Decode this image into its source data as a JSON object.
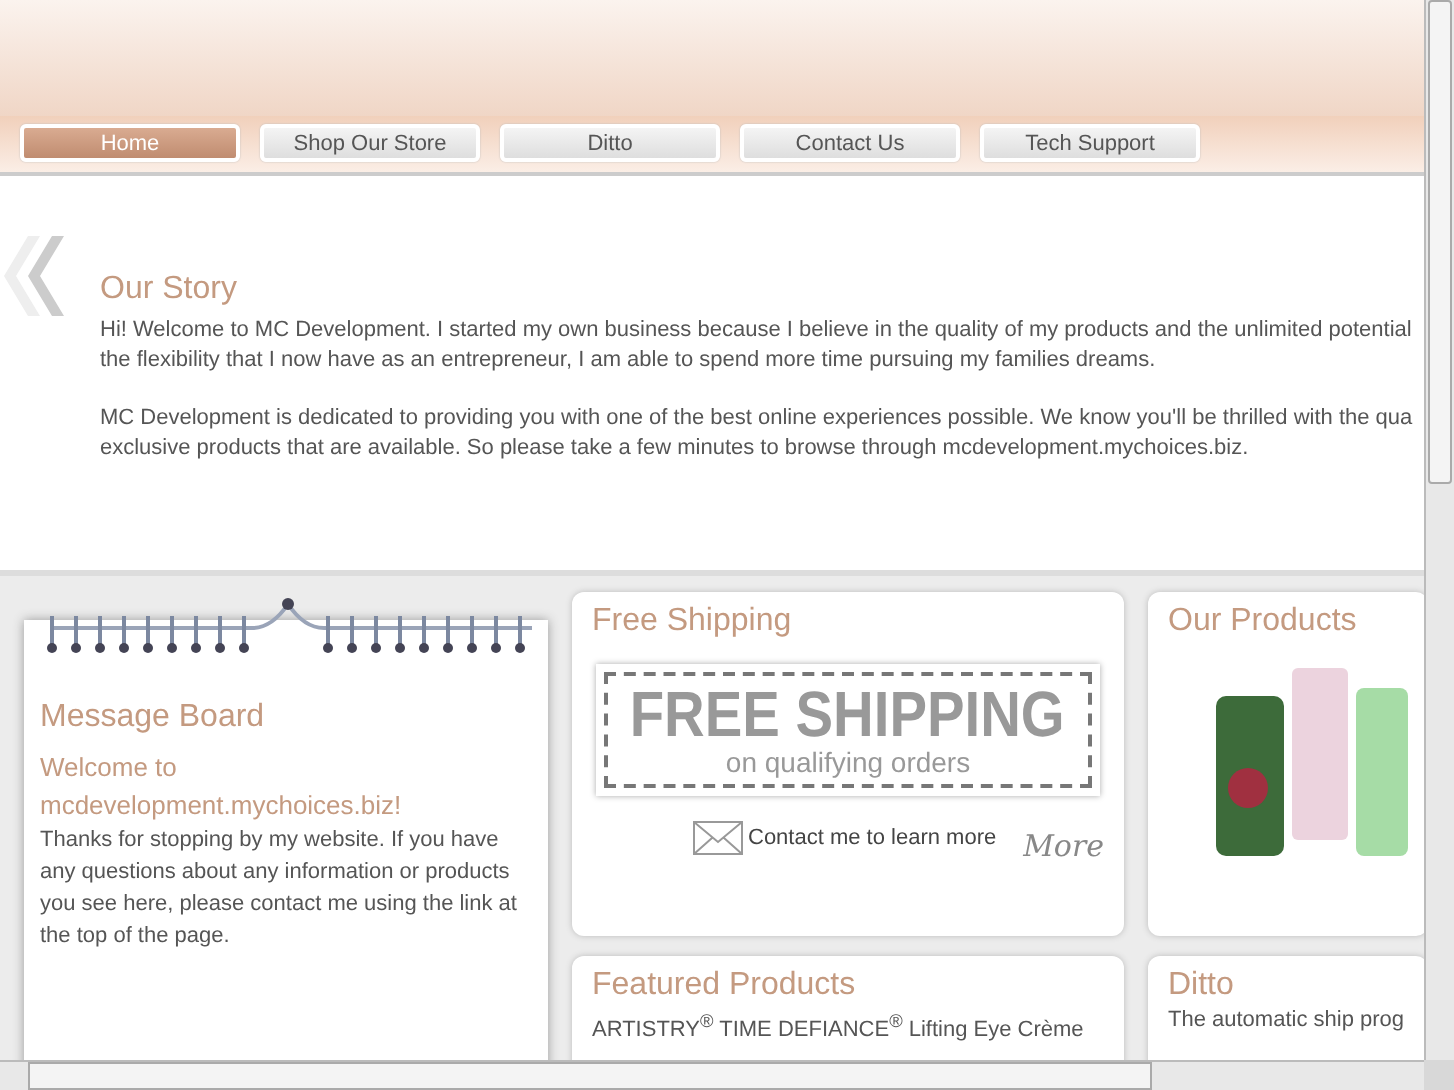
{
  "nav": [
    {
      "label": "Home",
      "selected": true
    },
    {
      "label": "Shop Our Store",
      "selected": false
    },
    {
      "label": "Ditto",
      "selected": false
    },
    {
      "label": "Contact Us",
      "selected": false
    },
    {
      "label": "Tech Support",
      "selected": false
    }
  ],
  "story": {
    "title": "Our Story",
    "paragraphs": [
      [
        "Hi! Welcome to MC Development. I started my own business because I believe in the quality of my products and the unlimited potential",
        "the flexibility that I now have as an entrepreneur, I am able to spend more time pursuing my families dreams."
      ],
      [
        "MC Development is dedicated to providing you with one of the best online experiences possible. We know you'll be thrilled with the qua",
        "exclusive products that are available. So please take a few minutes to browse through mcdevelopment.mychoices.biz."
      ]
    ]
  },
  "message_board": {
    "title": "Message Board",
    "welcome": "Welcome to mcdevelopment.mychoices.biz!",
    "body": "Thanks for stopping by my website. If you have any questions about any information or products you see here, please contact me using the link at the top of the page."
  },
  "free_shipping": {
    "title": "Free Shipping",
    "banner_title": "FREE SHIPPING",
    "banner_subtitle": "on qualifying orders",
    "contact_link": "Contact me to learn more",
    "more_link": "More"
  },
  "our_products": {
    "title": "Our Products"
  },
  "featured_products": {
    "title": "Featured Products",
    "item": "ARTISTRY$^{®}$ TIME DEFIANCE$^{®}$ Lifting Eye Crème"
  },
  "ditto": {
    "title": "Ditto",
    "text": "The automatic ship prog"
  }
}
